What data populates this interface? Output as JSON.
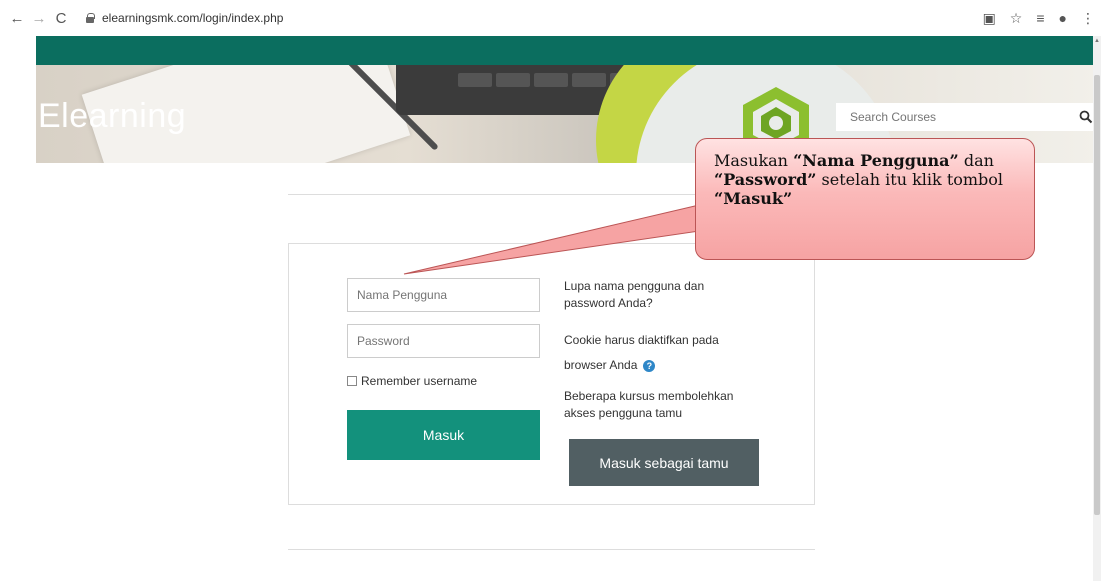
{
  "browser": {
    "url": "elearningsmk.com/login/index.php"
  },
  "header": {
    "title": "Elearning",
    "search_placeholder": "Search Courses"
  },
  "login": {
    "username_placeholder": "Nama Pengguna",
    "password_placeholder": "Password",
    "remember_label": "Remember username",
    "submit_label": "Masuk",
    "forgot_text": "Lupa nama pengguna dan password Anda?",
    "cookie_text": "Cookie harus diaktifkan pada browser Anda",
    "guest_text": "Beberapa kursus membolehkan akses pengguna tamu",
    "guest_button_label": "Masuk sebagai tamu"
  },
  "callout": {
    "part1": "Masukan ",
    "part2": "“Nama Pengguna”",
    "part3": " dan ",
    "part4": "“Password”",
    "part5": " setelah itu klik tombol ",
    "part6": "“Masuk”"
  },
  "colors": {
    "teal_bar": "#0b6e5f",
    "primary_button": "#13917c",
    "secondary_button": "#515f63",
    "callout_fill": "#f6a3a3",
    "help_icon": "#2e87c8"
  }
}
